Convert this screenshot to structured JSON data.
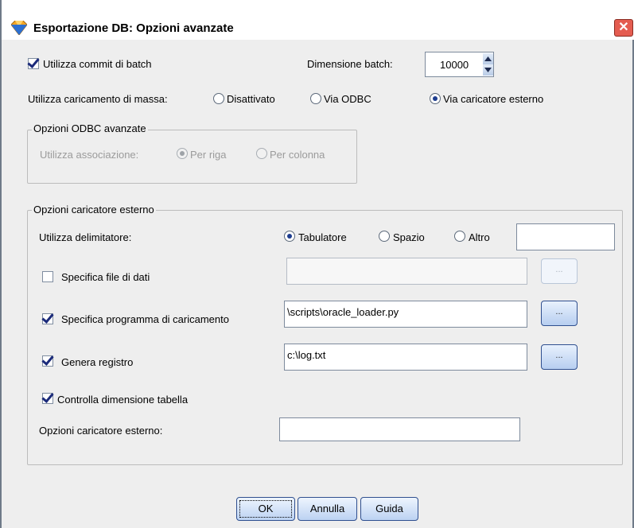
{
  "window": {
    "title": "Esportazione DB: Opzioni avanzate",
    "close_glyph": "✕"
  },
  "batch": {
    "commit_label": "Utilizza commit di batch",
    "commit_checked": true,
    "size_label": "Dimensione batch:",
    "size_value": "10000"
  },
  "bulk": {
    "label": "Utilizza caricamento di massa:",
    "options": [
      {
        "label": "Disattivato",
        "selected": false
      },
      {
        "label": "Via ODBC",
        "selected": false
      },
      {
        "label": "Via caricatore esterno",
        "selected": true
      }
    ]
  },
  "odbc": {
    "title": "Opzioni ODBC avanzate",
    "binding_label": "Utilizza associazione:",
    "options": [
      {
        "label": "Per riga",
        "selected": true
      },
      {
        "label": "Per colonna",
        "selected": false
      }
    ]
  },
  "loader": {
    "title": "Opzioni caricatore esterno",
    "delimiter_label": "Utilizza delimitatore:",
    "delimiters": [
      {
        "label": "Tabulatore",
        "selected": true
      },
      {
        "label": "Spazio",
        "selected": false
      },
      {
        "label": "Altro",
        "selected": false
      }
    ],
    "other_value": "",
    "data_file": {
      "label": "Specifica file di dati",
      "checked": false,
      "value": ""
    },
    "program": {
      "label": "Specifica programma di caricamento",
      "checked": true,
      "value": "\\scripts\\oracle_loader.py"
    },
    "log": {
      "label": "Genera registro",
      "checked": true,
      "value": "c:\\log.txt"
    },
    "check_size": {
      "label": "Controlla dimensione tabella",
      "checked": true
    },
    "options_label": "Opzioni caricatore esterno:",
    "options_value": "",
    "browse_label": "..."
  },
  "buttons": {
    "ok": "OK",
    "cancel": "Annulla",
    "help": "Guida"
  },
  "colors": {
    "accent": "#1e3d8f",
    "close": "#e45c50",
    "icon_orange": "#f5a623",
    "icon_blue": "#2b6fd1"
  }
}
